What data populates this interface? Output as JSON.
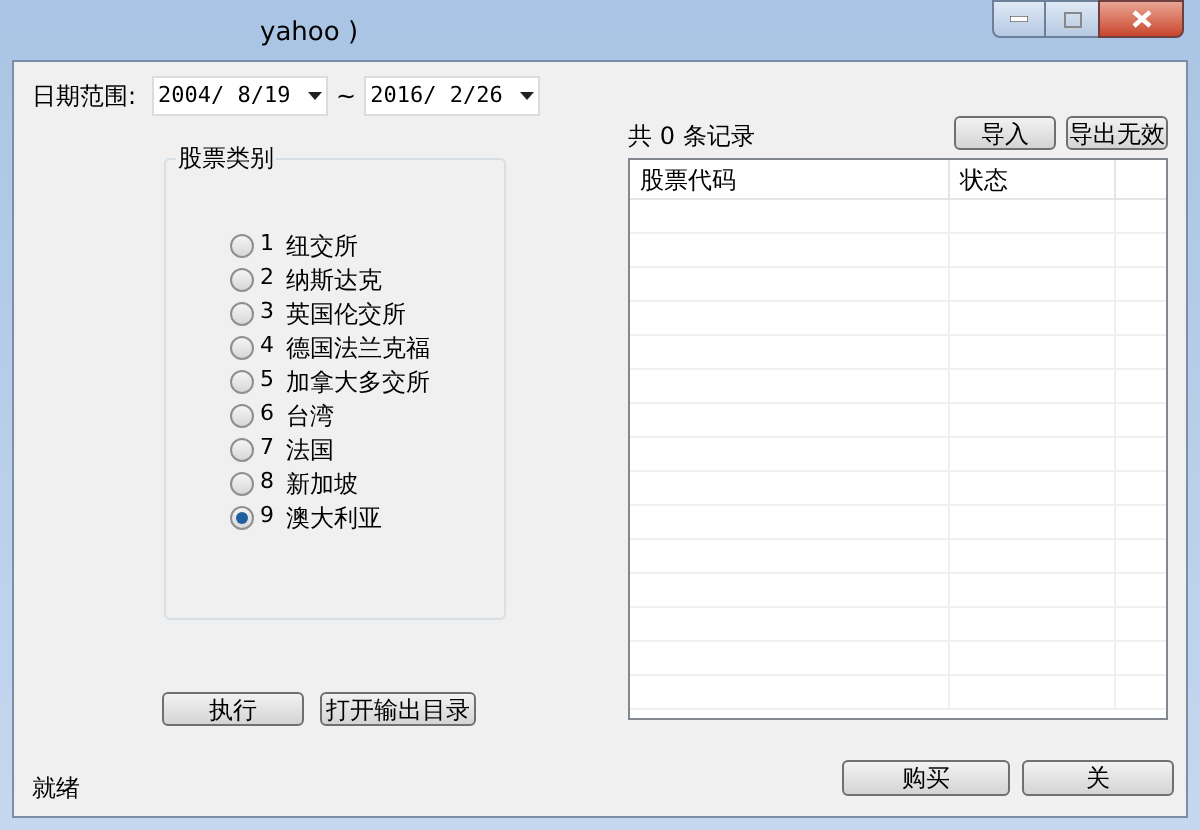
{
  "window": {
    "title": "yahoo )"
  },
  "date_range": {
    "label": "日期范围:",
    "separator": "~",
    "from": "2004/ 8/19",
    "to": "2016/ 2/26"
  },
  "stock_type": {
    "title": "股票类别",
    "options": [
      {
        "number": "1",
        "label": "纽交所",
        "selected": false
      },
      {
        "number": "2",
        "label": "纳斯达克",
        "selected": false
      },
      {
        "number": "3",
        "label": "英国伦交所",
        "selected": false
      },
      {
        "number": "4",
        "label": "德国法兰克福",
        "selected": false
      },
      {
        "number": "5",
        "label": "加拿大多交所",
        "selected": false
      },
      {
        "number": "6",
        "label": "台湾",
        "selected": false
      },
      {
        "number": "7",
        "label": "法国",
        "selected": false
      },
      {
        "number": "8",
        "label": "新加坡",
        "selected": false
      },
      {
        "number": "9",
        "label": "澳大利亚",
        "selected": true
      }
    ]
  },
  "actions": [
    "执行",
    "打开输出目录"
  ],
  "records": {
    "count_text": "共 0 条记录",
    "buttons": [
      "导入",
      "导出无效"
    ],
    "columns": [
      "股票代码",
      "状态"
    ]
  },
  "status_bar": "就绪",
  "footer_buttons": [
    "购买",
    "关"
  ]
}
